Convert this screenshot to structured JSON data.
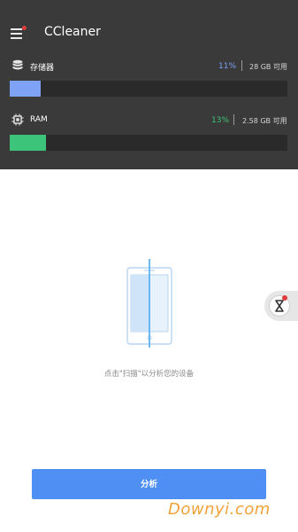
{
  "app": {
    "title": "CCleaner"
  },
  "storage": {
    "label": "存储器",
    "percent": "11%",
    "percent_value": 0.11,
    "available": "28 GB 可用"
  },
  "ram": {
    "label": "RAM",
    "percent": "13%",
    "percent_value": 0.13,
    "available": "2.58 GB 可用"
  },
  "main": {
    "hint": "点击\"扫描\"以分析您的设备"
  },
  "actions": {
    "analyze_label": "分析"
  },
  "watermark": {
    "text": "Downyi.com"
  },
  "colors": {
    "header_bg": "#3a3a3a",
    "storage_accent": "#7ea2f5",
    "ram_accent": "#3cc47a",
    "primary_button": "#4f8ff3",
    "notification_dot": "#e03a3a"
  },
  "icons": {
    "menu": "hamburger-menu-icon",
    "storage": "database-stack-icon",
    "ram": "chip-icon",
    "phone": "phone-scan-icon",
    "float": "hourglass-icon"
  }
}
